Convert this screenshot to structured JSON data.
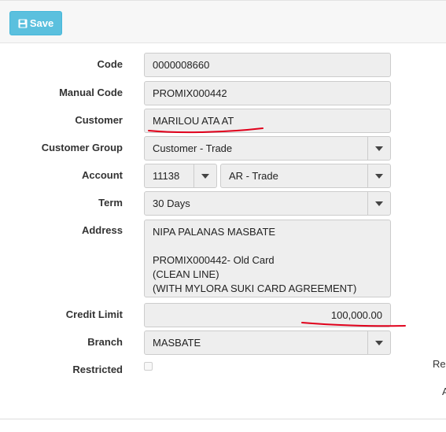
{
  "toolbar": {
    "save_label": "Save"
  },
  "form": {
    "code": {
      "label": "Code",
      "value": "0000008660"
    },
    "manual_code": {
      "label": "Manual Code",
      "value": "PROMIX000442"
    },
    "customer": {
      "label": "Customer",
      "value": "MARILOU ATA AT"
    },
    "customer_group": {
      "label": "Customer Group",
      "value": "Customer - Trade"
    },
    "account": {
      "label": "Account",
      "code_value": "11138",
      "name_value": "AR - Trade"
    },
    "term": {
      "label": "Term",
      "value": "30 Days"
    },
    "address": {
      "label": "Address",
      "lines": [
        "NIPA PALANAS MASBATE",
        "",
        "PROMIX000442- Old Card",
        "(CLEAN LINE)",
        "(WITH MYLORA SUKI CARD AGREEMENT)"
      ]
    },
    "credit_limit": {
      "label": "Credit Limit",
      "value": "100,000.00"
    },
    "branch": {
      "label": "Branch",
      "value": "MASBATE"
    },
    "restricted": {
      "label": "Restricted",
      "checked": false
    }
  },
  "right_edge": {
    "text_1": "Re",
    "text_2": "A"
  },
  "colors": {
    "save_button": "#5bc0de",
    "field_bg": "#eeeeee",
    "annotation": "#e0001b"
  },
  "icons": {
    "save": "floppy-disk-icon",
    "dropdown": "caret-down-icon"
  }
}
